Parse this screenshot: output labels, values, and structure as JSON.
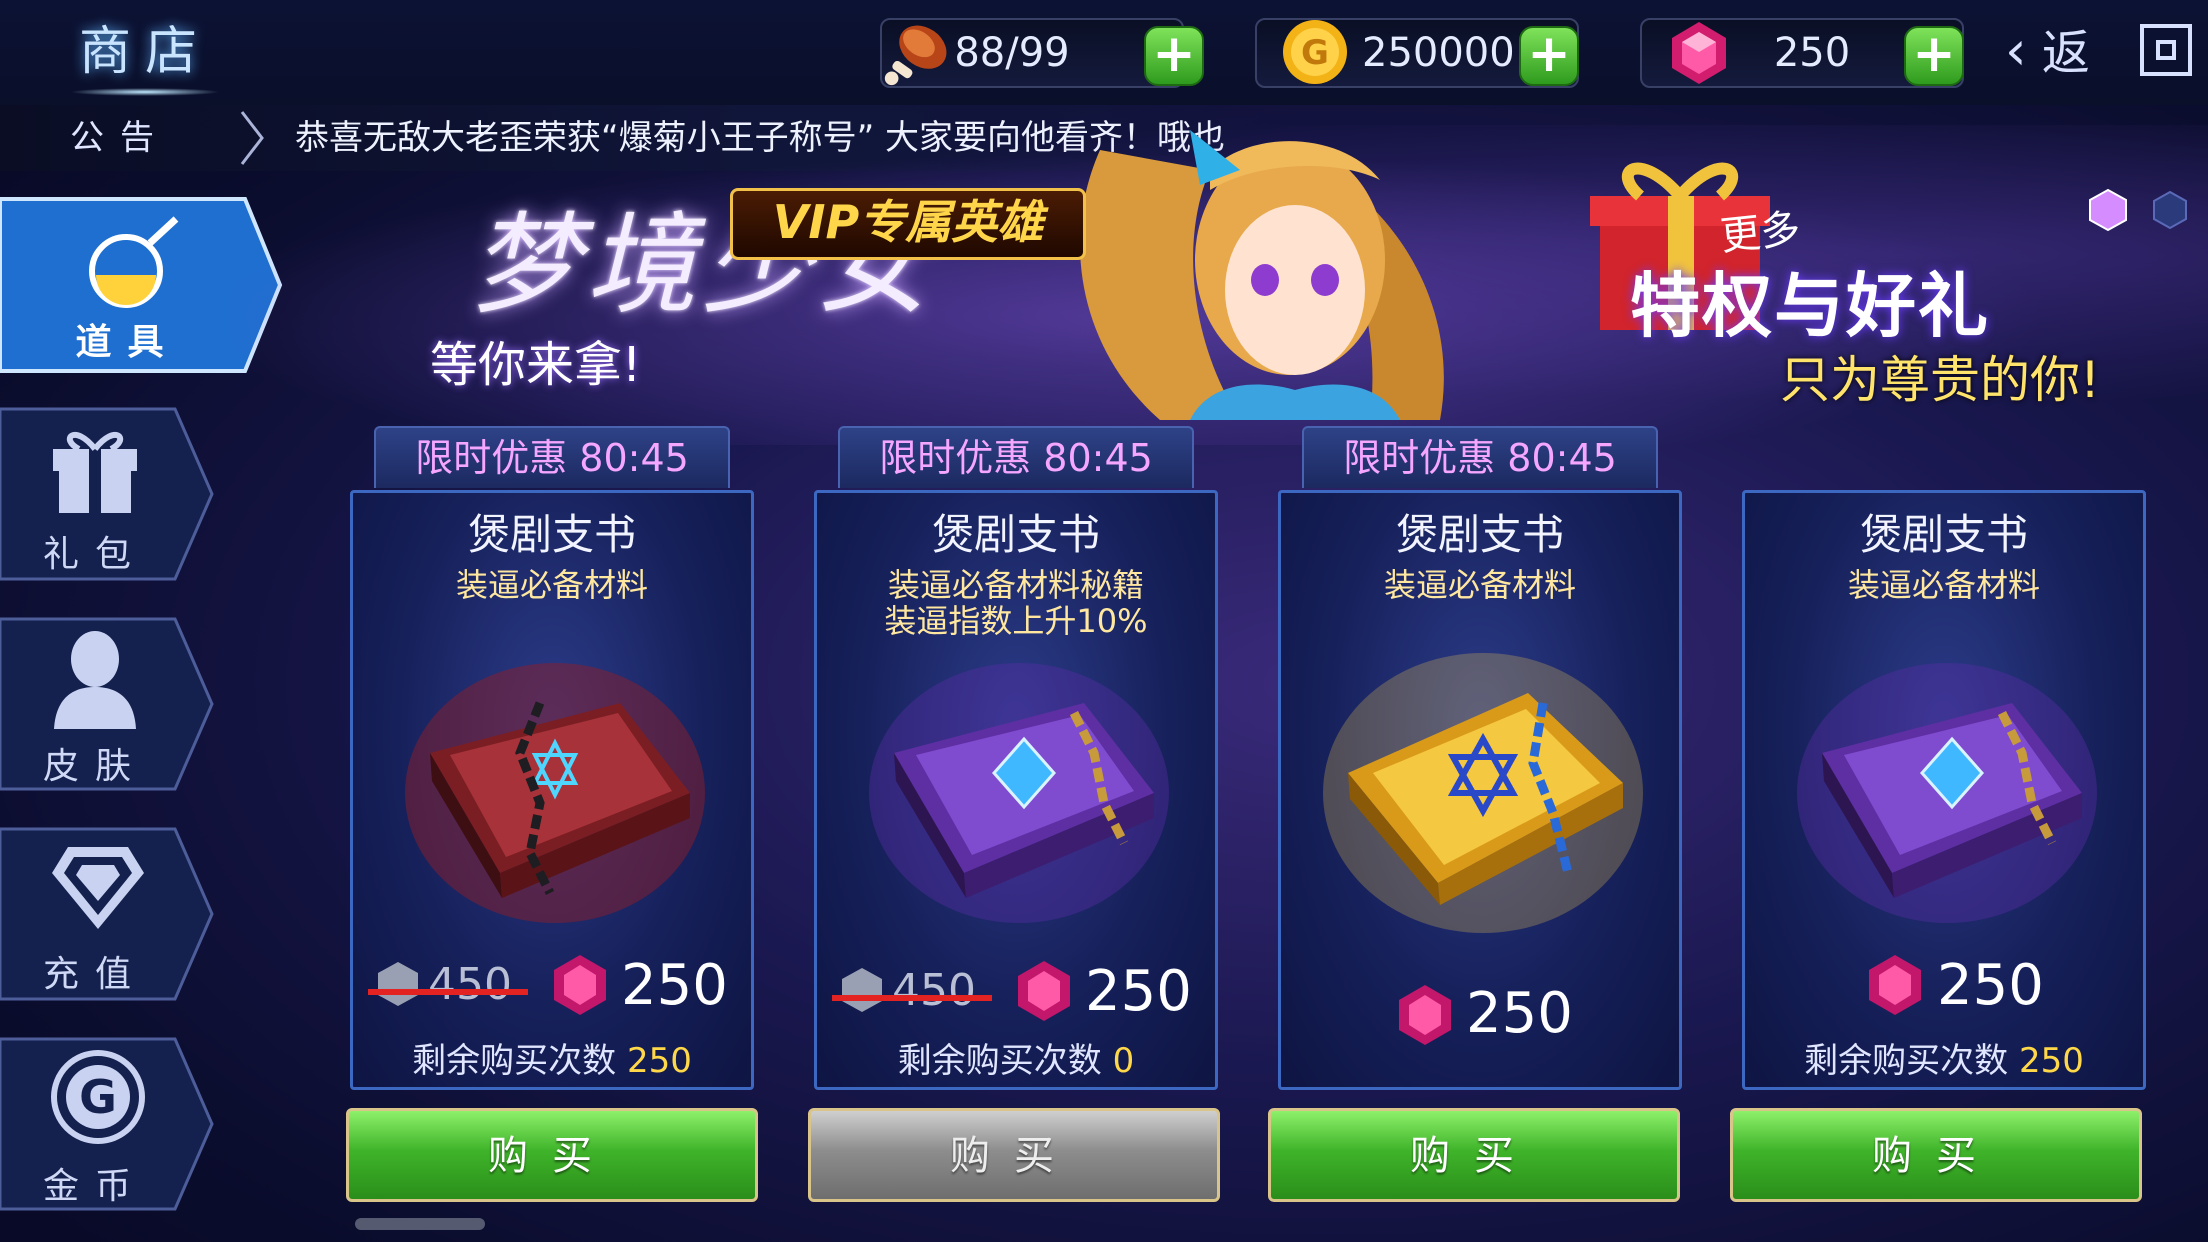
{
  "header": {
    "title": "商店",
    "stamina": "88/99",
    "gold": "250000",
    "gems": "250",
    "back_label": "返"
  },
  "notice": {
    "label": "公告",
    "text": "恭喜无敌大老歪荣获“爆菊小王子称号” 大家要向他看齐！哦也"
  },
  "sidebar": {
    "items": [
      {
        "label": "道具",
        "icon": "potion-flask-icon",
        "active": true
      },
      {
        "label": "礼包",
        "icon": "gift-box-icon"
      },
      {
        "label": "皮肤",
        "icon": "person-silhouette-icon"
      },
      {
        "label": "充值",
        "icon": "diamond-icon"
      },
      {
        "label": "金币",
        "icon": "gold-coin-icon"
      }
    ]
  },
  "banner": {
    "title": "梦境少女",
    "vip_tag": "VIP专属英雄",
    "subtitle": "等你来拿!",
    "more": "更多",
    "privilege": "特权与好礼",
    "for_you": "只为尊贵的你!"
  },
  "cards": [
    {
      "timer": "限时优惠 80:45",
      "name": "煲剧支书",
      "desc1": "装逼必备材料",
      "desc2": "",
      "old_price": "450",
      "price": "250",
      "stock_label": "剩余购买次数",
      "stock": "250",
      "buy": "购买",
      "book": "red",
      "enabled": true
    },
    {
      "timer": "限时优惠 80:45",
      "name": "煲剧支书",
      "desc1": "装逼必备材料秘籍",
      "desc2": "装逼指数上升10%",
      "old_price": "450",
      "price": "250",
      "stock_label": "剩余购买次数",
      "stock": "0",
      "buy": "购买",
      "book": "purple",
      "enabled": false
    },
    {
      "timer": "限时优惠 80:45",
      "name": "煲剧支书",
      "desc1": "装逼必备材料",
      "desc2": "",
      "old_price": "",
      "price": "250",
      "stock_label": "",
      "stock": "",
      "buy": "购买",
      "book": "gold",
      "enabled": true
    },
    {
      "timer": "",
      "name": "煲剧支书",
      "desc1": "装逼必备材料",
      "desc2": "",
      "old_price": "",
      "price": "250",
      "stock_label": "剩余购买次数",
      "stock": "250",
      "buy": "购买",
      "book": "purple",
      "enabled": true
    }
  ],
  "colors": {
    "accent_green": "#3fb42a",
    "gem_pink": "#e0287a",
    "timer_text": "#f5a6ff",
    "stock_value": "#ffd84a",
    "strike_red": "#e32222"
  }
}
